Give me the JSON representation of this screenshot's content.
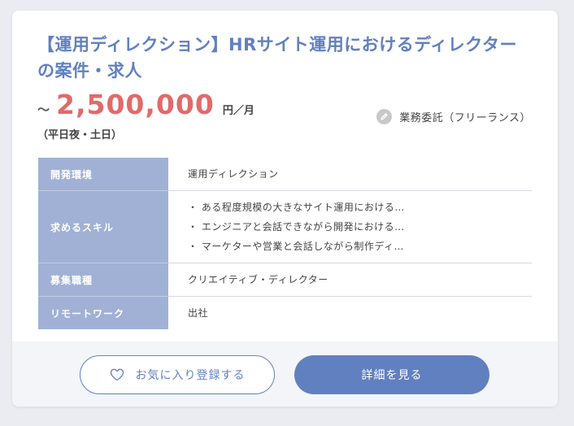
{
  "job": {
    "title": "【運用ディレクション】HRサイト運用におけるディレクターの案件・求人",
    "salary_prefix": "～",
    "salary_amount": "2,500,000",
    "salary_unit": "円／月",
    "salary_note": "（平日夜・土日）",
    "contract_type": "業務委託（フリーランス）",
    "contract_icon": "pencil-icon"
  },
  "table": {
    "rows": [
      {
        "label": "開発環境",
        "lines": [
          "運用ディレクション"
        ]
      },
      {
        "label": "求めるスキル",
        "lines": [
          "・ ある程度規模の大きなサイト運用における…",
          "・ エンジニアと会話できながら開発における…",
          "・ マーケターや営業と会話しながら制作ディ…"
        ]
      },
      {
        "label": "募集職種",
        "lines": [
          "クリエイティブ・ディレクター"
        ]
      },
      {
        "label": "リモートワーク",
        "lines": [
          "出社"
        ]
      }
    ]
  },
  "actions": {
    "favorite_label": "お気に入り登録する",
    "favorite_icon": "heart-icon",
    "detail_label": "詳細を見る"
  },
  "colors": {
    "accent": "#6180c0",
    "price": "#e06a6a",
    "table_header": "#a1b1d6",
    "footer_bg": "#f4f5f9"
  }
}
